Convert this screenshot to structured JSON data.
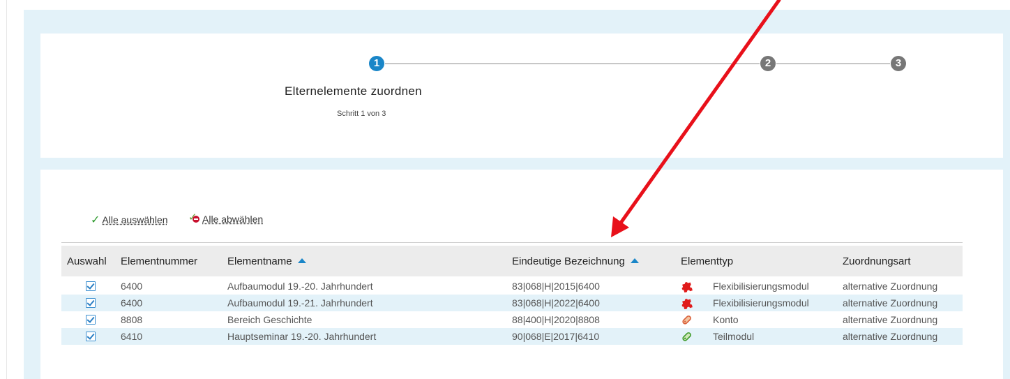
{
  "wizard": {
    "steps": [
      "1",
      "2",
      "3"
    ],
    "title": "Elternelemente zuordnen",
    "subtitle": "Schritt 1 von 3"
  },
  "actions": {
    "select_all": "Alle auswählen",
    "deselect_all": "Alle abwählen"
  },
  "table": {
    "headers": {
      "auswahl": "Auswahl",
      "elementnummer": "Elementnummer",
      "elementname": "Elementname",
      "bezeichnung": "Eindeutige Bezeichnung",
      "elementtyp": "Elementtyp",
      "zuordnungsart": "Zuordnungsart"
    },
    "rows": [
      {
        "nummer": "6400",
        "name": "Aufbaumodul 19.-20. Jahrhundert",
        "bezeichnung": "83|068|H|2015|6400",
        "typ": "Flexibilisierungsmodul",
        "typ_icon": "puzzle-red-icon",
        "zuordnung": "alternative Zuordnung",
        "checked": true
      },
      {
        "nummer": "6400",
        "name": "Aufbaumodul 19.-21. Jahrhundert",
        "bezeichnung": "83|068|H|2022|6400",
        "typ": "Flexibilisierungsmodul",
        "typ_icon": "puzzle-red-icon",
        "zuordnung": "alternative Zuordnung",
        "checked": true
      },
      {
        "nummer": "8808",
        "name": "Bereich Geschichte",
        "bezeichnung": "88|400|H|2020|8808",
        "typ": "Konto",
        "typ_icon": "tag-orange-icon",
        "zuordnung": "alternative Zuordnung",
        "checked": true
      },
      {
        "nummer": "6410",
        "name": "Hauptseminar 19.-20. Jahrhundert",
        "bezeichnung": "90|068|E|2017|6410",
        "typ": "Teilmodul",
        "typ_icon": "tag-green-icon",
        "zuordnung": "alternative Zuordnung",
        "checked": true
      }
    ]
  },
  "colors": {
    "accent": "#1a86c8",
    "annotation_arrow": "#e8101a",
    "row_alt": "#e3f2f9"
  }
}
